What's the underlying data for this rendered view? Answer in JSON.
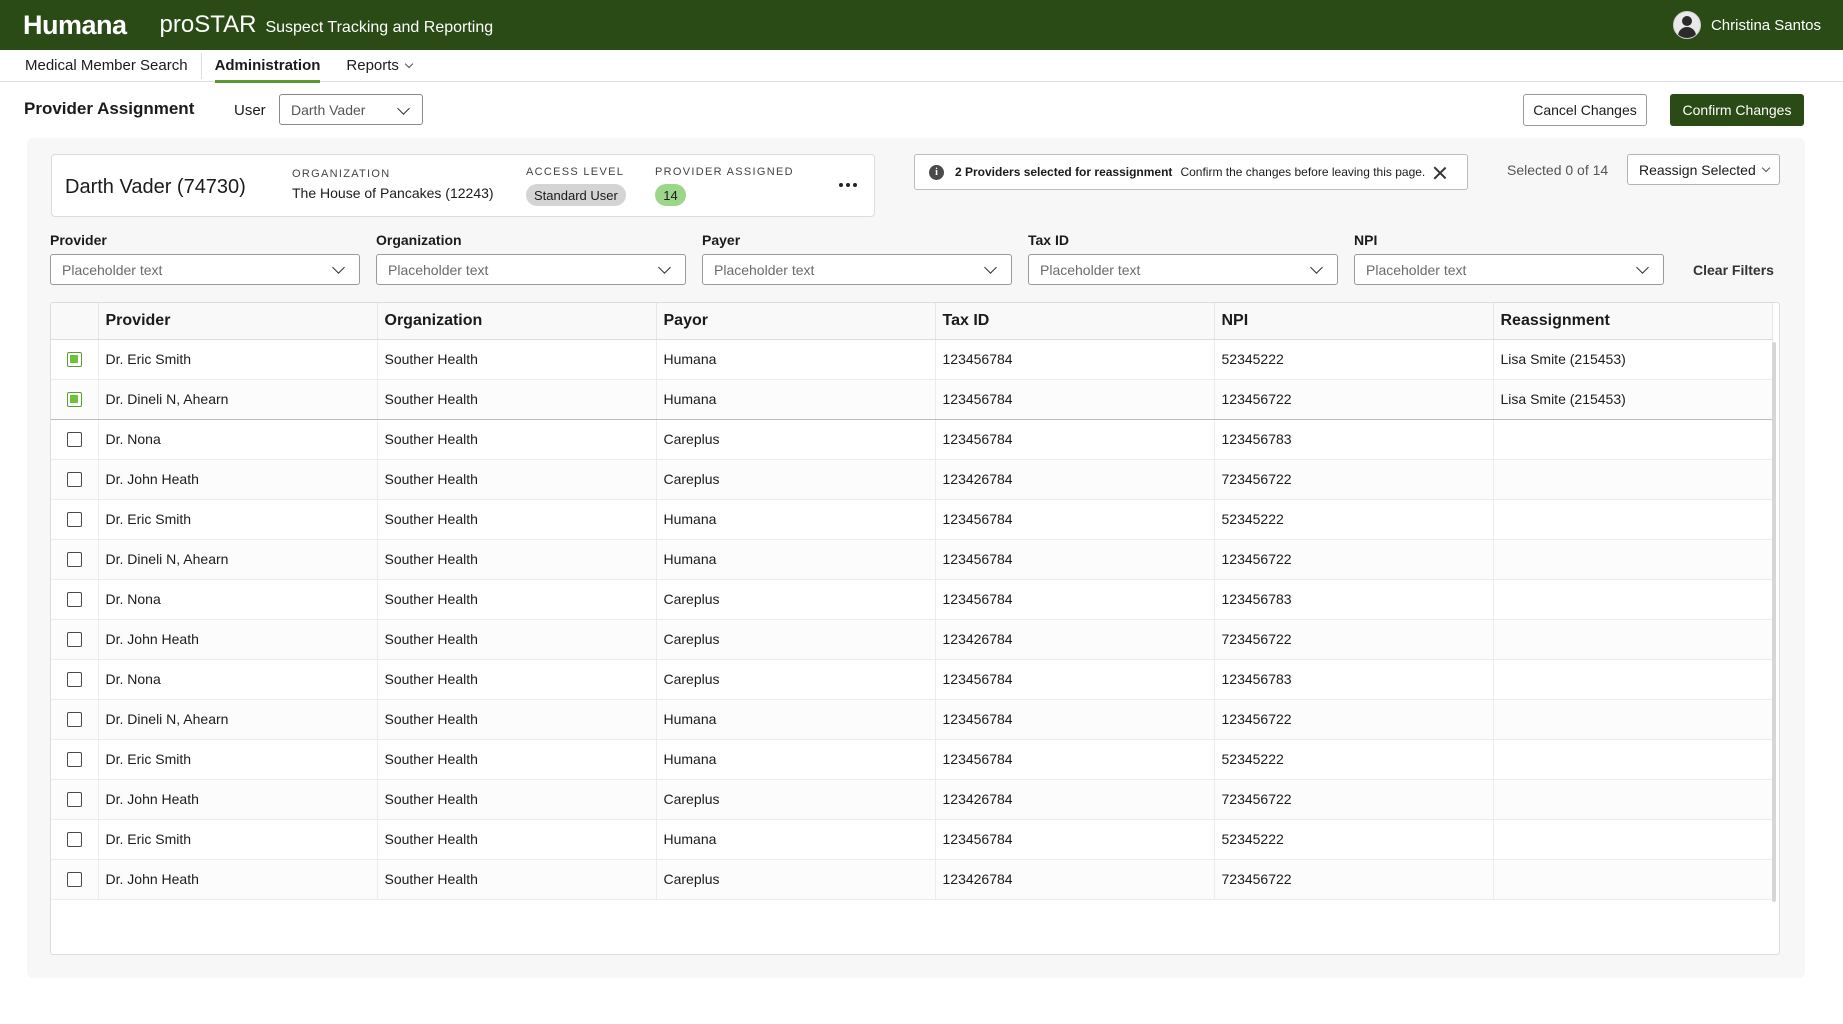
{
  "header": {
    "brand": "Humana",
    "product": "proSTAR",
    "product_subtitle": "Suspect Tracking and Reporting",
    "user_name": "Christina Santos"
  },
  "nav": {
    "items": [
      {
        "label": "Medical Member Search",
        "active": false
      },
      {
        "label": "Administration",
        "active": true
      },
      {
        "label": "Reports",
        "active": false
      }
    ]
  },
  "page": {
    "title": "Provider Assignment",
    "user_label": "User",
    "user_value": "Darth Vader",
    "cancel_label": "Cancel Changes",
    "confirm_label": "Confirm Changes"
  },
  "member": {
    "name": "Darth Vader (74730)",
    "organization_label": "ORGANIZATION",
    "organization": "The House of Pancakes (12243)",
    "access_level_label": "ACCESS LEVEL",
    "access_level": "Standard User",
    "provider_assigned_label": "PROVIDER ASSIGNED",
    "provider_assigned": "14"
  },
  "notice": {
    "strong": "2 Providers selected for reassignment",
    "text": "Confirm the changes before leaving this page."
  },
  "selection": {
    "count_text": "Selected 0 of 14",
    "reassign_label": "Reassign Selected"
  },
  "filters": {
    "items": [
      {
        "label": "Provider",
        "placeholder": "Placeholder text"
      },
      {
        "label": "Organization",
        "placeholder": "Placeholder text"
      },
      {
        "label": "Payer",
        "placeholder": "Placeholder text"
      },
      {
        "label": "Tax ID",
        "placeholder": "Placeholder text"
      },
      {
        "label": "NPI",
        "placeholder": "Placeholder text"
      }
    ],
    "clear_label": "Clear Filters"
  },
  "table": {
    "columns": [
      "Provider",
      "Organization",
      "Payor",
      "Tax ID",
      "NPI",
      "Reassignment"
    ],
    "rows": [
      {
        "checked": true,
        "provider": "Dr. Eric Smith",
        "organization": "Souther Health",
        "payor": "Humana",
        "tax_id": "123456784",
        "npi": "52345222",
        "reassignment": "Lisa Smite (215453)"
      },
      {
        "checked": true,
        "provider": "Dr. Dineli N, Ahearn",
        "organization": "Souther Health",
        "payor": "Humana",
        "tax_id": "123456784",
        "npi": "123456722",
        "reassignment": "Lisa Smite (215453)"
      },
      {
        "checked": false,
        "provider": "Dr. Nona",
        "organization": "Souther Health",
        "payor": "Careplus",
        "tax_id": "123456784",
        "npi": "123456783",
        "reassignment": ""
      },
      {
        "checked": false,
        "provider": "Dr. John Heath",
        "organization": "Souther Health",
        "payor": "Careplus",
        "tax_id": "123426784",
        "npi": "723456722",
        "reassignment": ""
      },
      {
        "checked": false,
        "provider": "Dr. Eric Smith",
        "organization": "Souther Health",
        "payor": "Humana",
        "tax_id": "123456784",
        "npi": "52345222",
        "reassignment": ""
      },
      {
        "checked": false,
        "provider": "Dr. Dineli N, Ahearn",
        "organization": "Souther Health",
        "payor": "Humana",
        "tax_id": "123456784",
        "npi": "123456722",
        "reassignment": ""
      },
      {
        "checked": false,
        "provider": "Dr. Nona",
        "organization": "Souther Health",
        "payor": "Careplus",
        "tax_id": "123456784",
        "npi": "123456783",
        "reassignment": ""
      },
      {
        "checked": false,
        "provider": "Dr. John Heath",
        "organization": "Souther Health",
        "payor": "Careplus",
        "tax_id": "123426784",
        "npi": "723456722",
        "reassignment": ""
      },
      {
        "checked": false,
        "provider": "Dr. Nona",
        "organization": "Souther Health",
        "payor": "Careplus",
        "tax_id": "123456784",
        "npi": "123456783",
        "reassignment": ""
      },
      {
        "checked": false,
        "provider": "Dr. Dineli N, Ahearn",
        "organization": "Souther Health",
        "payor": "Humana",
        "tax_id": "123456784",
        "npi": "123456722",
        "reassignment": ""
      },
      {
        "checked": false,
        "provider": "Dr. Eric Smith",
        "organization": "Souther Health",
        "payor": "Humana",
        "tax_id": "123456784",
        "npi": "52345222",
        "reassignment": ""
      },
      {
        "checked": false,
        "provider": "Dr. John Heath",
        "organization": "Souther Health",
        "payor": "Careplus",
        "tax_id": "123426784",
        "npi": "723456722",
        "reassignment": ""
      },
      {
        "checked": false,
        "provider": "Dr. Eric Smith",
        "organization": "Souther Health",
        "payor": "Humana",
        "tax_id": "123456784",
        "npi": "52345222",
        "reassignment": ""
      },
      {
        "checked": false,
        "provider": "Dr. John Heath",
        "organization": "Souther Health",
        "payor": "Careplus",
        "tax_id": "123426784",
        "npi": "723456722",
        "reassignment": ""
      }
    ]
  },
  "colors": {
    "brand_green": "#2a4a16",
    "accent_green": "#5a9a2a",
    "badge_green": "#9dd68a",
    "badge_gray": "#d4d4d4"
  }
}
